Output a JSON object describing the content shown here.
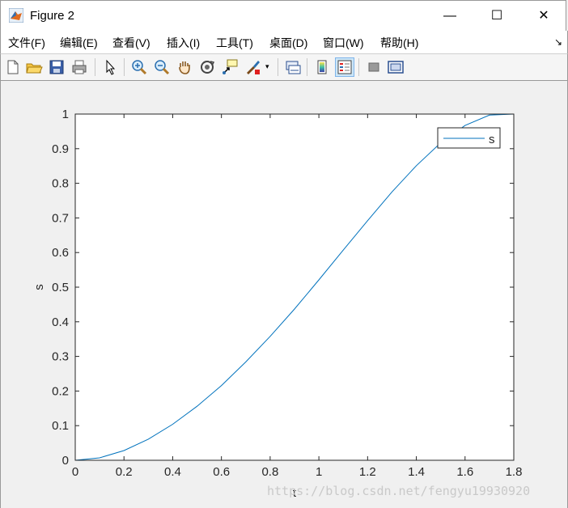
{
  "window": {
    "title": "Figure 2",
    "minimize_glyph": "—",
    "maximize_glyph": "☐",
    "close_glyph": "✕"
  },
  "menu": {
    "items": [
      "文件(F)",
      "编辑(E)",
      "查看(V)",
      "插入(I)",
      "工具(T)",
      "桌面(D)",
      "窗口(W)",
      "帮助(H)"
    ]
  },
  "toolbar": {
    "icons": [
      "new-figure-icon",
      "open-file-icon",
      "save-icon",
      "print-icon",
      "edit-plot-arrow-icon",
      "zoom-in-icon",
      "zoom-out-icon",
      "pan-hand-icon",
      "rotate-3d-icon",
      "data-cursor-icon",
      "brush-icon",
      "link-plot-icon",
      "colorbar-icon",
      "legend-icon",
      "hide-plot-tools-icon",
      "show-plot-tools-icon"
    ]
  },
  "colors": {
    "line": "#0072bd",
    "axes_bg": "#ffffff",
    "figure_bg": "#f0f0f0"
  },
  "chart_data": {
    "type": "line",
    "xlabel": "t",
    "ylabel": "s",
    "xlim": [
      0,
      1.8
    ],
    "ylim": [
      0,
      1
    ],
    "xticks": [
      "0",
      "0.2",
      "0.4",
      "0.6",
      "0.8",
      "1",
      "1.2",
      "1.4",
      "1.6",
      "1.8"
    ],
    "yticks": [
      "0",
      "0.1",
      "0.2",
      "0.3",
      "0.4",
      "0.5",
      "0.6",
      "0.7",
      "0.8",
      "0.9",
      "1"
    ],
    "legend": "top-right",
    "grid": false,
    "series": [
      {
        "name": "s",
        "x": [
          0,
          0.1,
          0.2,
          0.3,
          0.4,
          0.5,
          0.6,
          0.7,
          0.8,
          0.9,
          1.0,
          1.1,
          1.2,
          1.3,
          1.4,
          1.5,
          1.6,
          1.7,
          1.8
        ],
        "y": [
          0,
          0.007,
          0.028,
          0.061,
          0.104,
          0.156,
          0.216,
          0.284,
          0.358,
          0.437,
          0.521,
          0.607,
          0.692,
          0.775,
          0.851,
          0.917,
          0.967,
          0.997,
          1.0
        ]
      }
    ]
  },
  "watermark": "https://blog.csdn.net/fengyu19930920"
}
